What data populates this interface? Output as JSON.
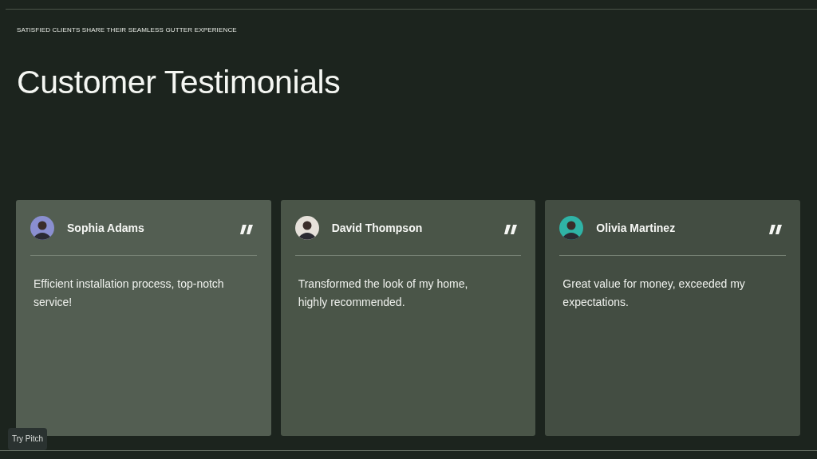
{
  "eyebrow": "SATISFIED CLIENTS SHARE THEIR SEAMLESS GUTTER EXPERIENCE",
  "title": "Customer Testimonials",
  "testimonials": [
    {
      "name": "Sophia Adams",
      "quote": "Efficient installation process, top-notch service!",
      "color": "#535e52"
    },
    {
      "name": "David Thompson",
      "quote": "Transformed the look of my home, highly recommended.",
      "color": "#4a5548"
    },
    {
      "name": "Olivia Martinez",
      "quote": "Great value for money, exceeded my expectations.",
      "color": "#434d42"
    }
  ],
  "badge": "Try Pitch"
}
